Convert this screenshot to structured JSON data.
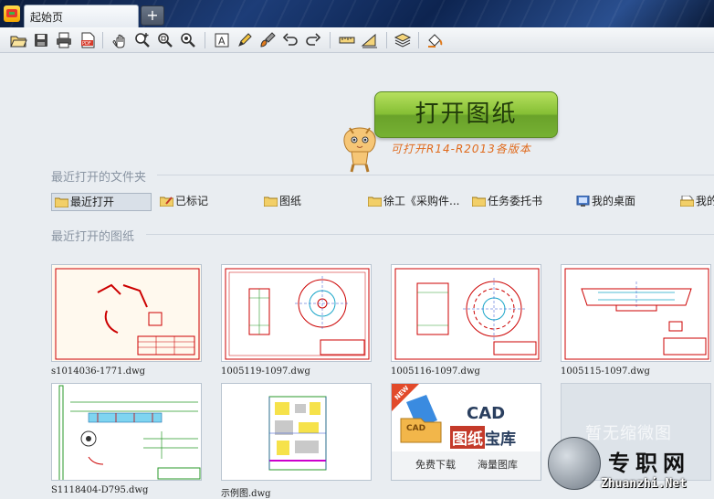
{
  "titlebar": {
    "tab_label": "起始页",
    "add_tab_glyph": "+"
  },
  "toolbar": {
    "icons": [
      "open-folder-icon",
      "save-icon",
      "print-icon",
      "pdf-icon",
      "pan-icon",
      "zoom-in-icon",
      "zoom-window-icon",
      "zoom-extents-icon",
      "text-icon",
      "pencil-icon",
      "brush-icon",
      "undo-icon",
      "redo-icon",
      "measure-icon",
      "dimension-icon",
      "layers-icon",
      "paint-bucket-icon"
    ]
  },
  "hero": {
    "open_button_label": "打开图纸",
    "versions_text": "可打开R14-R2013各版本"
  },
  "recent_folders": {
    "title": "最近打开的文件夹",
    "items": [
      {
        "label": "最近打开",
        "icon": "folder-icon"
      },
      {
        "label": "已标记",
        "icon": "bookmark-folder-icon"
      },
      {
        "label": "图纸",
        "icon": "folder-icon"
      },
      {
        "label": "徐工《采购件...",
        "icon": "folder-icon"
      },
      {
        "label": "任务委托书",
        "icon": "folder-icon"
      },
      {
        "label": "我的桌面",
        "icon": "desktop-icon"
      },
      {
        "label": "我的",
        "icon": "document-icon"
      }
    ]
  },
  "recent_drawings": {
    "title": "最近打开的图纸",
    "items": [
      {
        "label": "s1014036-1771.dwg"
      },
      {
        "label": "1005119-1097.dwg"
      },
      {
        "label": "1005116-1097.dwg"
      },
      {
        "label": "1005115-1097.dwg"
      },
      {
        "label": "S1118404-D795.dwg"
      },
      {
        "label": "示例图.dwg"
      },
      {
        "label": ""
      },
      {
        "label": ""
      }
    ],
    "promo": {
      "badge": "NEW",
      "cad": "CAD",
      "title_a": "图纸",
      "title_b": "宝库",
      "left": "免费下载",
      "right": "海量图库",
      "folder_text": "CAD"
    },
    "no_thumb_text": "暂无缩微图"
  },
  "watermark": {
    "line1": "专职网",
    "line2": "Zhuanzhi.Net"
  }
}
